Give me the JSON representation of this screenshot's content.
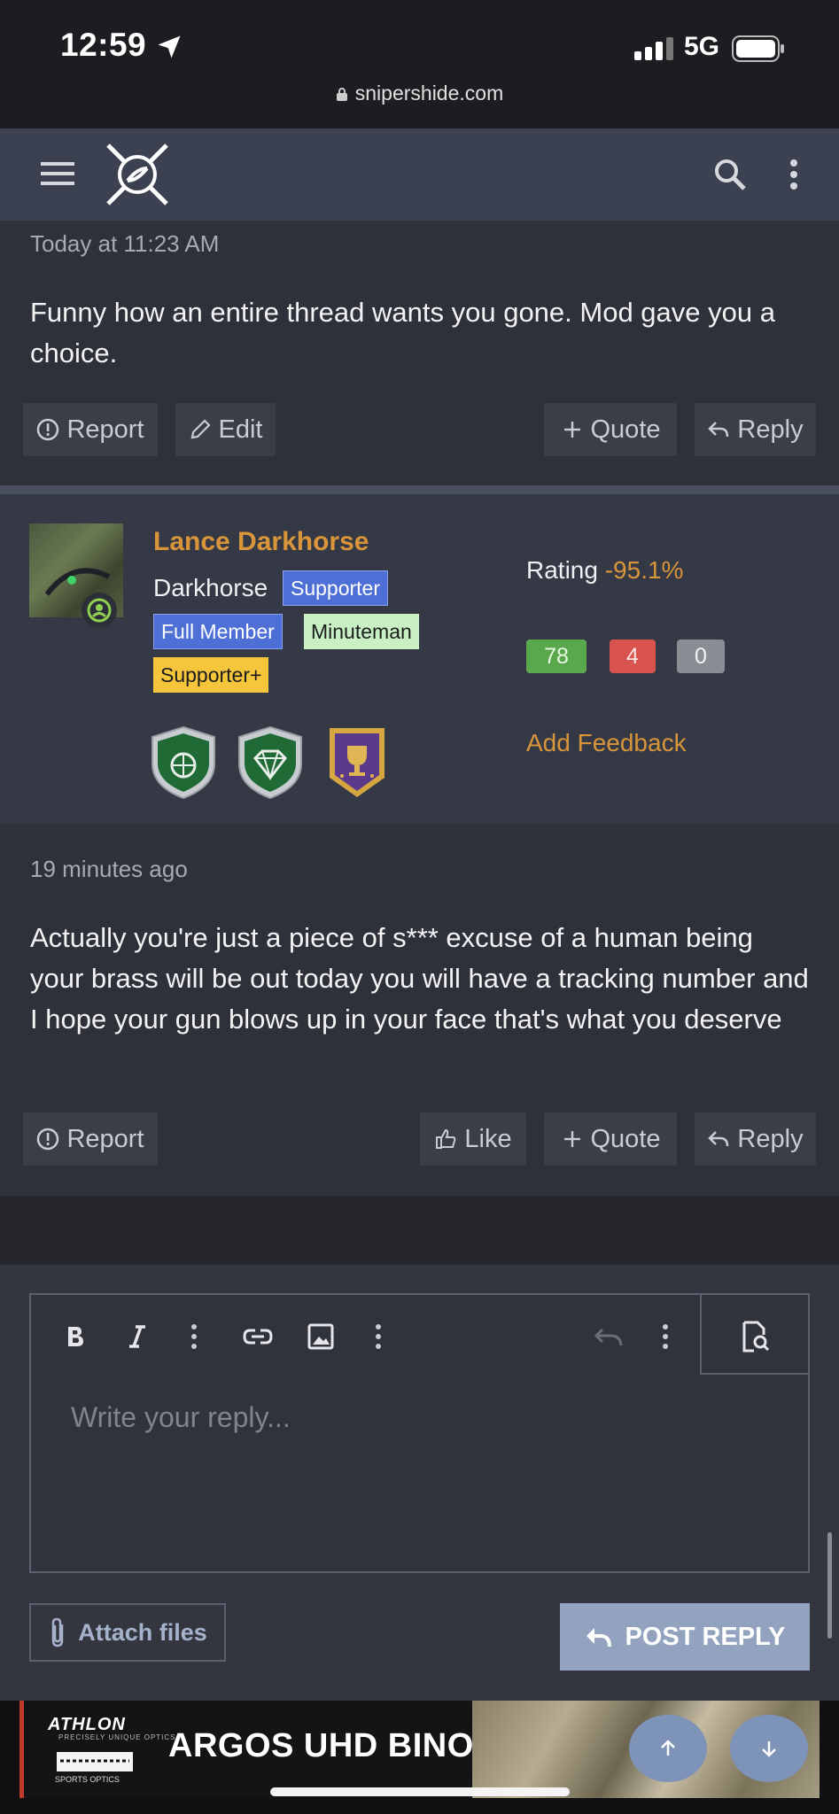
{
  "status": {
    "time": "12:59",
    "network": "5G",
    "url": "snipershide.com"
  },
  "icons": [
    "location-arrow-icon",
    "signal-icon",
    "battery-icon",
    "lock-icon",
    "hamburger-icon",
    "site-logo",
    "search-icon",
    "kebab-icon",
    "report-icon",
    "edit-icon",
    "plus-icon",
    "reply-icon",
    "like-icon",
    "bold-icon",
    "italic-icon",
    "link-icon",
    "image-icon",
    "undo-icon",
    "preview-icon",
    "paperclip-icon"
  ],
  "post1": {
    "timestamp": "Today at 11:23 AM",
    "message": "Funny how an entire thread wants you gone. Mod gave you a choice.",
    "actions": {
      "report": "Report",
      "edit": "Edit",
      "quote": "Quote",
      "reply": "Reply"
    }
  },
  "user": {
    "name": "Lance Darkhorse",
    "title": "Darkhorse",
    "badges": {
      "supporter": "Supporter",
      "full_member": "Full Member",
      "minuteman": "Minuteman",
      "supporter_plus": "Supporter+"
    },
    "rating_label": "Rating",
    "rating_value": "-95.1%",
    "feedback": {
      "positive": "78",
      "negative": "4",
      "neutral": "0"
    },
    "add_feedback": "Add Feedback",
    "colors": {
      "username": "#d9953a",
      "positive": "#59a84b",
      "negative": "#d9534f",
      "neutral": "#8a8d94"
    }
  },
  "post2": {
    "timestamp": "19 minutes ago",
    "message": "Actually you're just a piece of s*** excuse of a human being your brass will be out today you will have a tracking number and I hope your gun blows up in your face that's what you deserve",
    "actions": {
      "report": "Report",
      "like": "Like",
      "quote": "Quote",
      "reply": "Reply"
    }
  },
  "editor": {
    "placeholder": "Write your reply...",
    "attach": "Attach files",
    "post_reply": "POST REPLY"
  },
  "ad": {
    "brand": "ATHLON",
    "brand_sub": "PRECISELY UNIQUE OPTICS",
    "partner": "SPORTS OPTICS",
    "headline": "ARGOS UHD BINOS"
  }
}
